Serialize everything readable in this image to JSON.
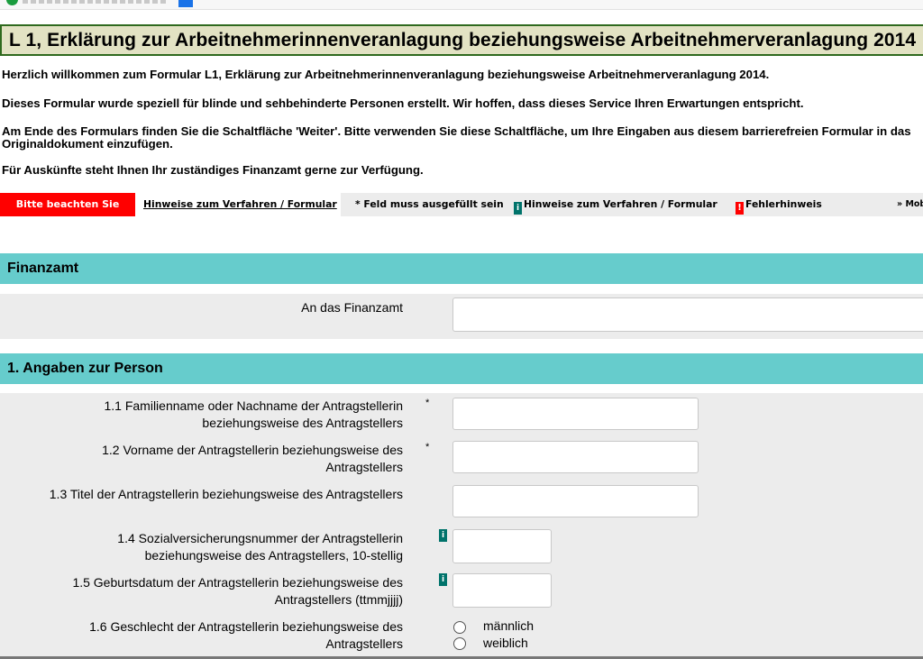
{
  "title": "L 1, Erklärung zur Arbeitnehmerinnenveranlagung beziehungsweise Arbeitnehmerveranlagung 2014",
  "intro": {
    "p1": "Herzlich willkommen zum Formular L1, Erklärung zur Arbeitnehmerinnenveranlagung beziehungsweise Arbeitnehmerveranlagung 2014.",
    "p2": "Dieses Formular wurde speziell für blinde und sehbehinderte Personen erstellt. Wir hoffen, dass dieses Service Ihren Erwartungen entspricht.",
    "p3": "Am Ende des Formulars finden Sie die Schaltfläche 'Weiter'. Bitte verwenden Sie diese Schaltfläche, um Ihre Eingaben aus diesem barrierefreien Formular in das Originaldokument einzufügen.",
    "p4": "Für Auskünfte steht Ihnen Ihr zuständiges Finanzamt gerne zur Verfügung."
  },
  "legend": {
    "beachten": "Bitte beachten Sie",
    "hinweise_link": "Hinweise zum Verfahren / Formular",
    "pflicht": "* Feld muss ausgefüllt sein",
    "info_icon": "i",
    "info_text": "Hinweise zum Verfahren / Formular",
    "error_icon": "!",
    "error_text": "Fehlerhinweis",
    "mobil": "» Mobi"
  },
  "finanzamt": {
    "heading": "Finanzamt",
    "label": "An das Finanzamt",
    "value": ""
  },
  "person": {
    "heading": "1. Angaben zur Person",
    "star": "*",
    "info_icon": "i",
    "f1_label": "1.1 Familienname oder Nachname der Antragstellerin beziehungsweise des Antragstellers",
    "f2_label": "1.2 Vorname der Antragstellerin beziehungsweise des Antragstellers",
    "f3_label": "1.3 Titel der Antragstellerin beziehungsweise des Antragstellers",
    "f4_label": "1.4 Sozialversicherungsnummer der Antragstellerin beziehungsweise des Antragstellers, 10-stellig",
    "f5_label": "1.5 Geburtsdatum der Antragstellerin beziehungsweise des Antragstellers (ttmmjjjj)",
    "f6_label": "1.6 Geschlecht der Antragstellerin beziehungsweise des Antragstellers",
    "f6_opt_m": "männlich",
    "f6_opt_w": "weiblich",
    "f1_value": "",
    "f2_value": "",
    "f3_value": "",
    "f4_value": "",
    "f5_value": ""
  },
  "colors": {
    "section_teal": "#66cccc",
    "title_bg": "#e2e2c3",
    "title_border": "#2f6a1e",
    "info_teal": "#00736b",
    "alert_red": "#ff0000"
  }
}
